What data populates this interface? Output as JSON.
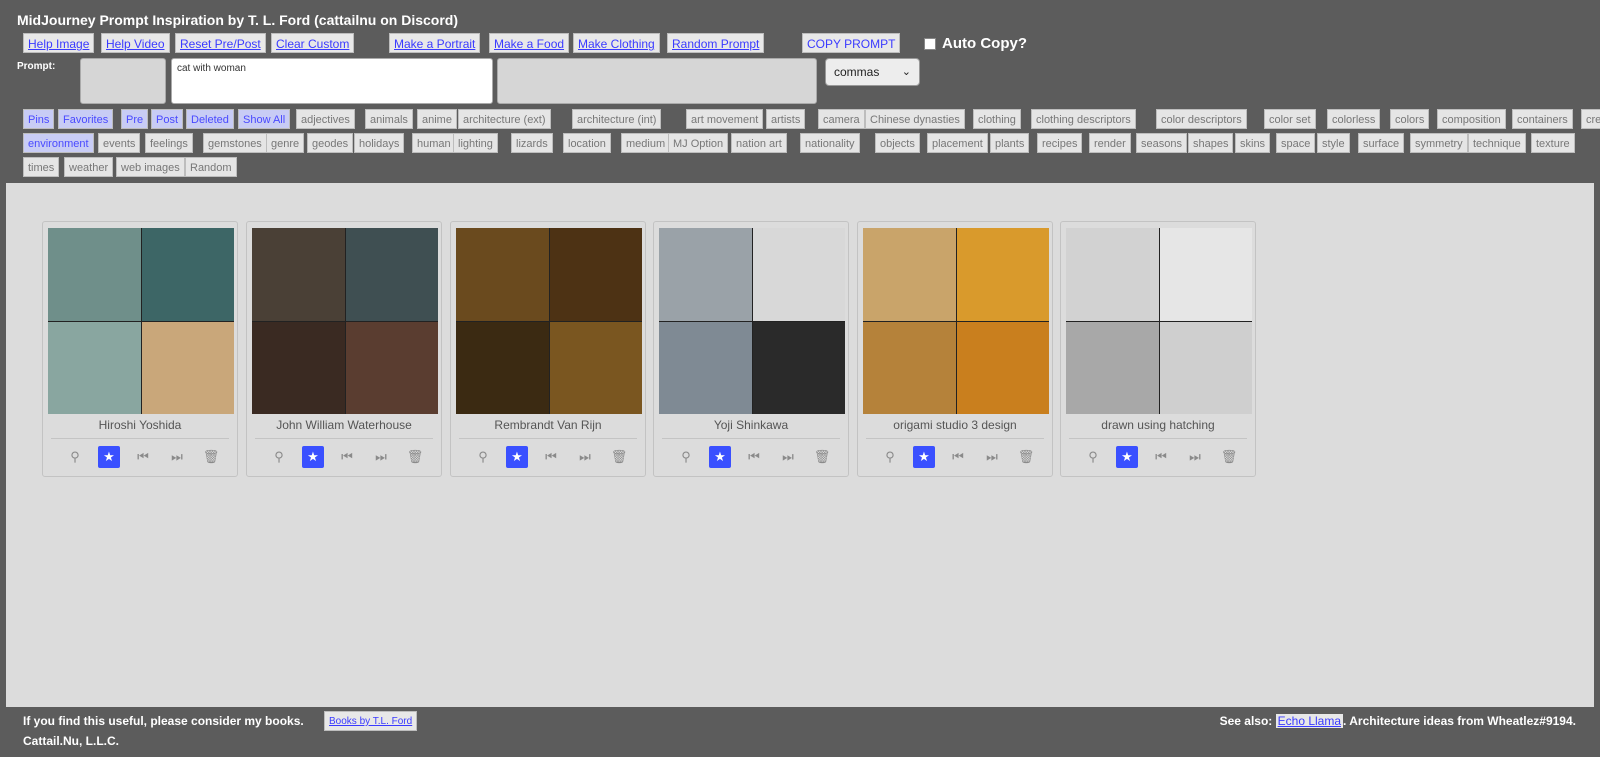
{
  "app": {
    "title": "MidJourney Prompt Inspiration by T. L. Ford (cattailnu on Discord)"
  },
  "toolbar": {
    "buttons": [
      "Help Image",
      "Help Video",
      "Reset Pre/Post",
      "Clear Custom",
      "Make a Portrait",
      "Make a Food",
      "Make Clothing",
      "Random Prompt",
      "COPY PROMPT"
    ],
    "auto_copy_label": "Auto Copy?"
  },
  "prompt": {
    "label": "Prompt:",
    "value": "cat with woman",
    "separator": "commas"
  },
  "categories": {
    "row1": [
      "Pins",
      "Favorites",
      "Pre",
      "Post",
      "Deleted",
      "Show All",
      "adjectives",
      "animals",
      "anime",
      "architecture (ext)",
      "architecture (int)",
      "art movement",
      "artists",
      "camera",
      "Chinese dynasties",
      "clothing",
      "clothing descriptors",
      "color descriptors",
      "color set",
      "colorless",
      "colors",
      "composition",
      "containers",
      "creatures"
    ],
    "row2": [
      "environment",
      "events",
      "feelings",
      "gemstones",
      "genre",
      "geodes",
      "holidays",
      "human",
      "lighting",
      "lizards",
      "location",
      "medium",
      "MJ Option",
      "nation art",
      "nationality",
      "objects",
      "placement",
      "plants",
      "recipes",
      "render",
      "seasons",
      "shapes",
      "skins",
      "space",
      "style",
      "surface",
      "symmetry",
      "technique",
      "texture"
    ],
    "row3": [
      "times",
      "weather",
      "web images",
      "Random"
    ],
    "active": [
      "Pins",
      "Favorites",
      "Pre",
      "Post",
      "Deleted",
      "Show All",
      "environment"
    ]
  },
  "cards": [
    {
      "label": "Hiroshi Yoshida",
      "colors": [
        "#6f8f8a",
        "#3d6666",
        "#89a6a0",
        "#c9a77a"
      ]
    },
    {
      "label": "John William Waterhouse",
      "colors": [
        "#4a4036",
        "#3f4f52",
        "#3a2a22",
        "#5a3d30"
      ]
    },
    {
      "label": "Rembrandt Van Rijn",
      "colors": [
        "#6a4a1e",
        "#4d3214",
        "#3b2a12",
        "#7a5620"
      ]
    },
    {
      "label": "Yoji Shinkawa",
      "colors": [
        "#9aa2a8",
        "#d8d8d8",
        "#7f8a94",
        "#2a2a2a"
      ]
    },
    {
      "label": "origami studio 3 design",
      "colors": [
        "#c9a46a",
        "#d99a2c",
        "#b5823a",
        "#c97f1e"
      ]
    },
    {
      "label": "drawn using hatching",
      "colors": [
        "#d2d2d2",
        "#e6e6e6",
        "#a8a8a8",
        "#cfcfcf"
      ]
    }
  ],
  "card_actions": [
    "pin-icon",
    "favorite-icon",
    "pre-icon",
    "post-icon",
    "delete-icon"
  ],
  "footer": {
    "left_text": "If you find this useful, please consider my books.",
    "books_button": "Books by T.L. Ford",
    "company": "Cattail.Nu, L.L.C.",
    "see_also_prefix": "See also:",
    "see_also_link": "Echo Llama",
    "see_also_suffix": ". Architecture ideas from Wheatlez#9194."
  }
}
